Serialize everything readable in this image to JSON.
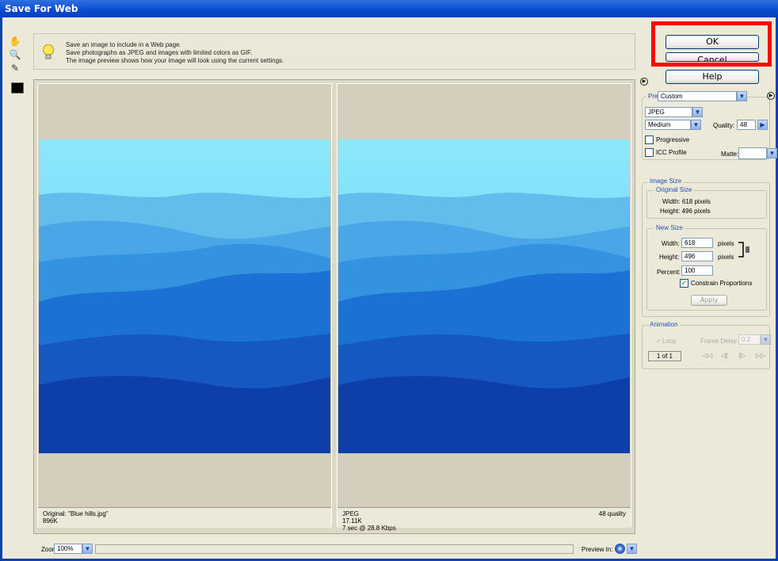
{
  "window": {
    "title": "Save For Web"
  },
  "info": {
    "lines": [
      "Save an image to include in a Web page.",
      "Save photographs as JPEG and images with limited colors as GIF.",
      "The image preview shows how your image will look using the current settings."
    ]
  },
  "buttons": {
    "ok": "OK",
    "cancel": "Cancel",
    "help": "Help",
    "apply": "Apply"
  },
  "settings": {
    "preset_label": "Preset:",
    "preset_value": "Custom",
    "format": "JPEG",
    "compression": "Medium",
    "quality_label": "Quality:",
    "quality_value": "48",
    "progressive_label": "Progressive",
    "icc_label": "ICC Profile",
    "matte_label": "Matte:"
  },
  "image_size": {
    "title": "Image Size",
    "original_title": "Original Size",
    "orig_width": "Width: 618 pixels",
    "orig_height": "Height: 496 pixels",
    "new_title": "New Size",
    "width_label": "Width:",
    "width_value": "618",
    "height_label": "Height:",
    "height_value": "496",
    "pixels_unit": "pixels",
    "percent_label": "Percent:",
    "percent_value": "100",
    "constrain_label": "Constrain Proportions"
  },
  "animation": {
    "title": "Animation",
    "loop_label": "Loop",
    "frame_delay_label": "Frame Delay:",
    "frame_delay_value": "0.2",
    "frame_counter": "1 of 1"
  },
  "preview": {
    "left_line1": "Original: \"Blue hills.jpg\"",
    "left_line2": "896K",
    "right_line1": "JPEG",
    "right_line2": "17.11K",
    "right_line3": "7 sec @ 28.8 Kbps",
    "right_quality": "48 quality"
  },
  "zoom": {
    "label": "Zoom:",
    "value": "100%",
    "preview_in_label": "Preview In:"
  },
  "colors": {
    "highlight": "#ff0000",
    "titlebar": "#0a4bd0"
  }
}
